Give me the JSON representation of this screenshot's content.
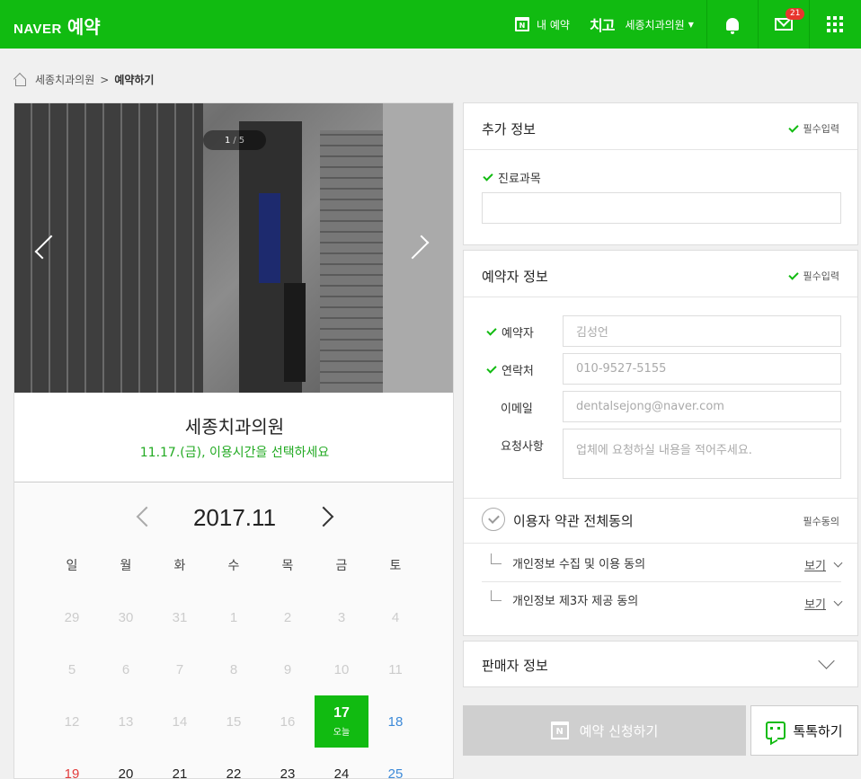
{
  "header": {
    "logo_brand": "NAVER",
    "logo_service": "예약",
    "my_booking_icon": "calendar-n-icon",
    "my_booking_label": "내 예약",
    "chigo_label": "치고",
    "user_label": "세종치과의원",
    "notification_icon": "bell-icon",
    "mail_icon": "mail-icon",
    "mail_badge": "21",
    "apps_icon": "grid-icon",
    "accent_color": "#11bb11"
  },
  "breadcrumb": {
    "home_icon": "home-icon",
    "parent": "세종치과의원",
    "separator": ">",
    "current": "예약하기"
  },
  "gallery": {
    "current_index": "1",
    "separator": "/",
    "total": "5"
  },
  "shop": {
    "name": "세종치과의원",
    "subtitle": "11.17.(금), 이용시간을 선택하세요"
  },
  "calendar": {
    "title": "2017.11",
    "weekdays": [
      "일",
      "월",
      "화",
      "수",
      "목",
      "금",
      "토"
    ],
    "weeks": [
      [
        "29",
        "30",
        "31",
        "1",
        "2",
        "3",
        "4"
      ],
      [
        "5",
        "6",
        "7",
        "8",
        "9",
        "10",
        "11"
      ],
      [
        "12",
        "13",
        "14",
        "15",
        "16",
        "17",
        "18"
      ],
      [
        "19",
        "20",
        "21",
        "22",
        "23",
        "24",
        "25"
      ]
    ],
    "today_label": "오늘",
    "today_color": "#11bb11",
    "sunday_color": "#e23c3c",
    "saturday_color": "#3d8ad8"
  },
  "extra_info": {
    "title": "추가 정보",
    "required": "필수입력",
    "field_label": "진료과목",
    "field_value": ""
  },
  "booker_info": {
    "title": "예약자 정보",
    "required": "필수입력",
    "name_label": "예약자",
    "name_value": "김성언",
    "phone_label": "연락처",
    "phone_value": "010-9527-5155",
    "email_label": "이메일",
    "email_value": "dentalsejong@naver.com",
    "request_label": "요청사항",
    "request_placeholder": "업체에 요청하실 내용을 적어주세요."
  },
  "terms": {
    "agree_all": "이용자 약관 전체동의",
    "required": "필수동의",
    "items": [
      {
        "label": "개인정보 수집 및 이용 동의",
        "link": "보기"
      },
      {
        "label": "개인정보 제3자 제공 동의",
        "link": "보기"
      }
    ]
  },
  "seller": {
    "title": "판매자 정보"
  },
  "actions": {
    "book_label": "예약 신청하기",
    "talk_label": "톡톡하기"
  }
}
